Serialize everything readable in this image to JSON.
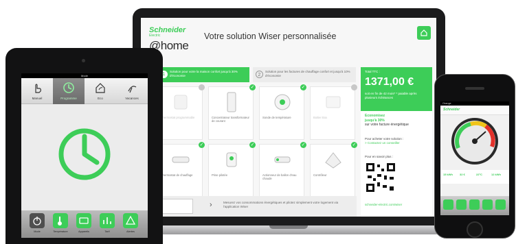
{
  "laptop": {
    "brand_name": "Schneider",
    "brand_sub": "Electric",
    "brand_home": "@home",
    "title": "Votre solution Wiser personnalisée",
    "step1": {
      "num": "1",
      "text": "Solution pour votre la maison confort jusqu'à 30% d'économie"
    },
    "step2": {
      "num": "2",
      "text": "Solution pour les factures de chauffage confort et jusqu'à 10% d'économie"
    },
    "products": [
      {
        "name": "Thermostat programmable",
        "price": "",
        "selected": false,
        "icon": "thermostat-icon"
      },
      {
        "name": "Concentrateur transformateur de courant",
        "price": "",
        "selected": true,
        "icon": "hub-icon"
      },
      {
        "name": "Sonde de température",
        "price": "",
        "selected": true,
        "icon": "sensor-icon"
      },
      {
        "name": "Boitier Box",
        "price": "",
        "selected": false,
        "icon": "box-icon"
      },
      {
        "name": "Thermostat de chauffage",
        "price": "",
        "selected": true,
        "icon": "heating-thermostat-icon"
      },
      {
        "name": "Prise pilotée",
        "price": "",
        "selected": true,
        "icon": "smart-plug-icon"
      },
      {
        "name": "Actionneur de ballon d'eau chaude",
        "price": "",
        "selected": true,
        "icon": "actuator-icon"
      },
      {
        "name": "Contrôleur",
        "price": "",
        "selected": true,
        "icon": "controller-icon"
      }
    ],
    "bottom_text": "Mesurez vos consommations énergétiques et pilotez simplement votre logement via l'application Wiser",
    "total_label": "Total TTC :",
    "total_value": "1371,00 €",
    "total_monthly": "soit en fin de 42 mois* * paiable après plusieurs échéances",
    "economy_title": "Economisez",
    "economy_value": "jusqu'à 30%",
    "economy_text": "sur votre facture énergétique",
    "buy_text": "Pour acheter votre solution :",
    "buy_link": "> Contactez un conseiller",
    "more_text": "Pour en savoir plus :",
    "url": "schneider-electric.com/wiser"
  },
  "tablet": {
    "status": "Mode",
    "modes": [
      {
        "label": "Manuel",
        "icon": "hand-icon",
        "active": false
      },
      {
        "label": "Programme",
        "icon": "clock-icon",
        "active": true
      },
      {
        "label": "Eco",
        "icon": "eco-house-icon",
        "active": false
      },
      {
        "label": "Vacances",
        "icon": "vacation-icon",
        "active": false
      }
    ],
    "dock": [
      {
        "label": "Mode",
        "icon": "power-icon"
      },
      {
        "label": "Température",
        "icon": "temperature-icon"
      },
      {
        "label": "Appareils",
        "icon": "devices-icon"
      },
      {
        "label": "Tarif",
        "icon": "tariff-icon"
      },
      {
        "label": "Alertes",
        "icon": "alert-icon"
      }
    ],
    "accent": "#3dcd58"
  },
  "phone": {
    "status": "Orange",
    "logo": "Schneider",
    "stats": [
      "15 kWh",
      "32 €",
      "22°C",
      "12 kWh"
    ]
  }
}
